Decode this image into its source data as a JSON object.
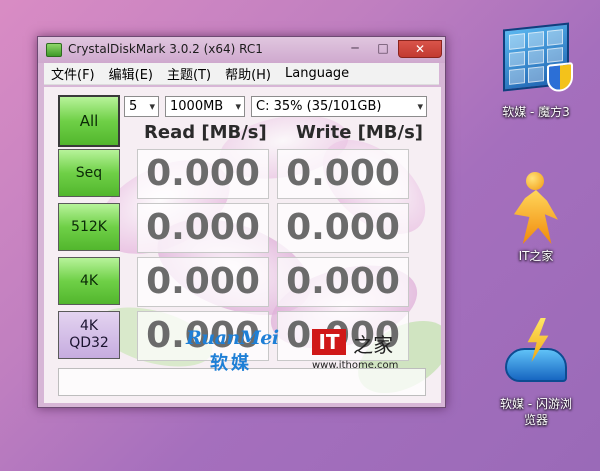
{
  "window": {
    "title": "CrystalDiskMark 3.0.2 (x64) RC1",
    "min_glyph": "─",
    "max_glyph": "□",
    "close_glyph": "✕"
  },
  "menu": [
    "文件(F)",
    "编辑(E)",
    "主题(T)",
    "帮助(H)",
    "Language"
  ],
  "controls": {
    "count": "5",
    "size": "1000MB",
    "drive": "C: 35% (35/101GB)",
    "caret": "▾"
  },
  "headers": {
    "read": "Read [MB/s]",
    "write": "Write [MB/s]"
  },
  "buttons": {
    "all": "All",
    "seq": "Seq",
    "k512": "512K",
    "k4": "4K",
    "qd32_line1": "4K",
    "qd32_line2": "QD32"
  },
  "results": {
    "seq_read": "0.000",
    "seq_write": "0.000",
    "k512_read": "0.000",
    "k512_write": "0.000",
    "k4_read": "0.000",
    "k4_write": "0.000",
    "qd32_read": "0.000",
    "qd32_write": "0.000"
  },
  "watermark": {
    "ruanmei_latin": "RuanMei",
    "ruanmei_cn": "软媒",
    "it_mark": "IT",
    "it_cn": "之家",
    "it_url": "www.ithome.com"
  },
  "desktop": {
    "rubik_label": "软媒 - 魔方3",
    "ithome_label": "IT之家",
    "browser_label_1": "软媒 - 闪游浏",
    "browser_label_2": "览器"
  },
  "colors": {
    "button_green": "#6fd047",
    "qd32_button": "#c6acdf",
    "close_red": "#c23a31",
    "watermark_blue": "#1e7fd6",
    "it_red": "#d01818"
  }
}
